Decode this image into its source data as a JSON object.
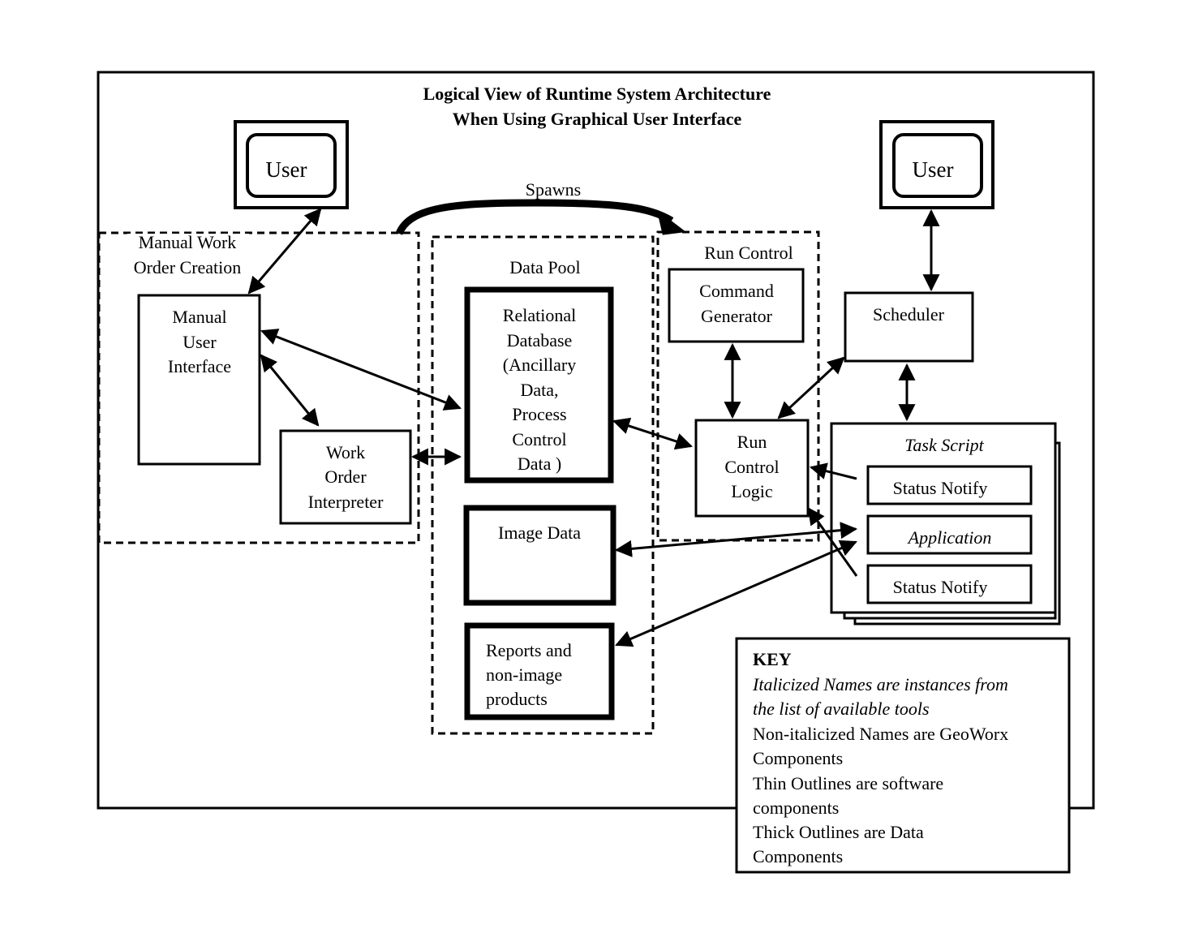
{
  "title": {
    "line1": "Logical View of Runtime System Architecture",
    "line2": "When Using Graphical User Interface"
  },
  "users": {
    "left": "User",
    "right": "User"
  },
  "spawns_label": "Spawns",
  "groups": {
    "manual_work_order": [
      "Manual Work",
      "Order Creation"
    ],
    "data_pool": "Data Pool",
    "run_control": "Run Control"
  },
  "components": {
    "manual_user_interface": [
      "Manual",
      "User",
      "Interface"
    ],
    "work_order_interpreter": [
      "Work",
      "Order",
      "Interpreter"
    ],
    "relational_database": [
      "Relational",
      "Database",
      "(Ancillary",
      "Data,",
      "Process",
      "Control",
      "Data )"
    ],
    "image_data": "Image Data",
    "reports": [
      "Reports and",
      "non-image",
      "products"
    ],
    "command_generator": [
      "Command",
      "Generator"
    ],
    "run_control_logic": [
      "Run",
      "Control",
      "Logic"
    ],
    "scheduler": "Scheduler",
    "task_script": "Task Script",
    "status_notify_top": "Status Notify",
    "application": "Application",
    "status_notify_bottom": "Status Notify"
  },
  "key": {
    "heading": "KEY",
    "italic_lines": [
      "Italicized Names are instances from",
      "the list of available tools"
    ],
    "lines": [
      "Non-italicized Names are GeoWorx",
      "Components",
      "Thin Outlines are software",
      "components",
      "Thick Outlines are Data",
      "Components"
    ]
  },
  "colors": {
    "ink": "#000000",
    "paper": "#ffffff"
  }
}
